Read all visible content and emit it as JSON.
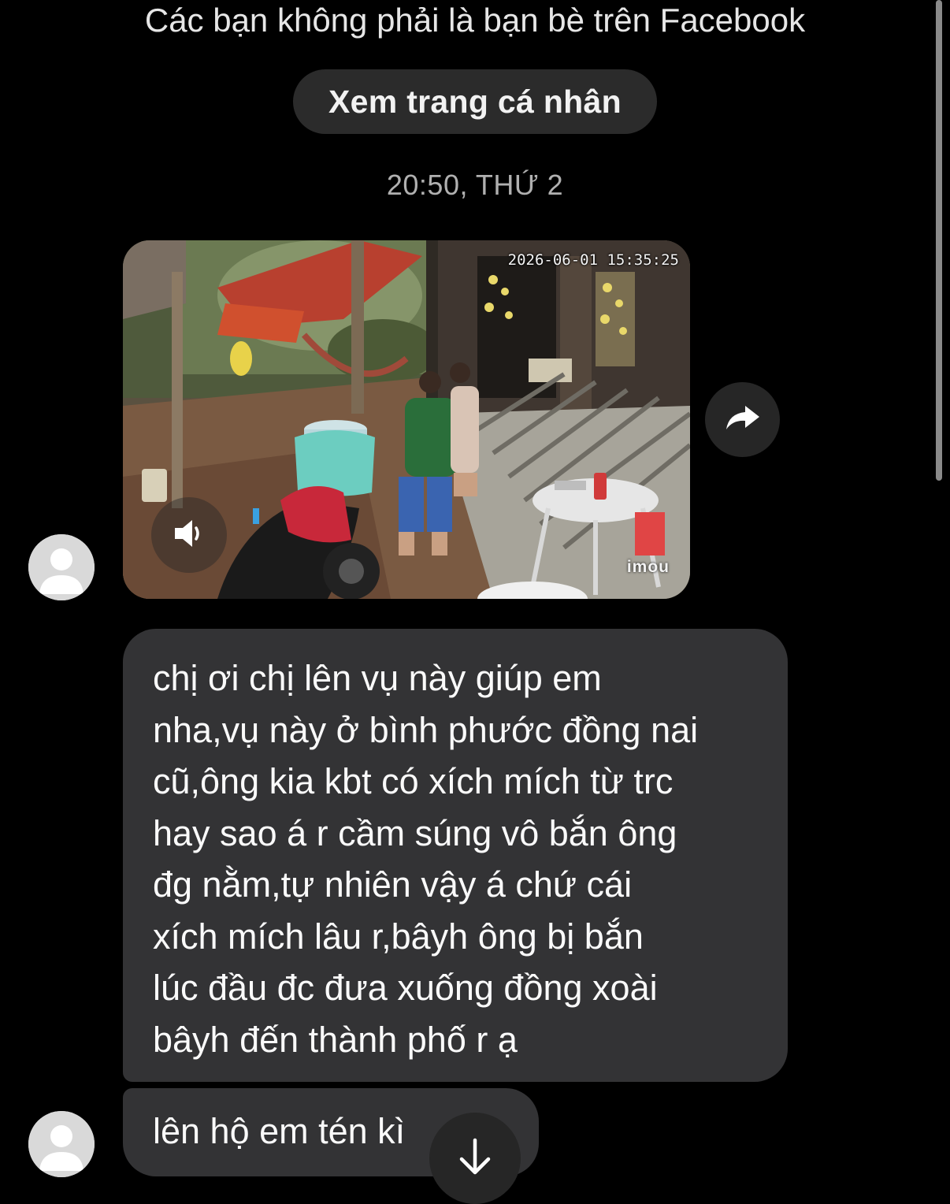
{
  "header": {
    "not_friends_notice": "Các bạn không phải là bạn bè trên Facebook",
    "view_profile_label": "Xem trang cá nhân"
  },
  "conversation": {
    "timestamp": "20:50, THỨ 2"
  },
  "video_message": {
    "camera_timestamp": "2026-06-01 15:35:25",
    "camera_brand": "imou",
    "sound_icon": "speaker-icon",
    "share_icon": "share-arrow-icon"
  },
  "messages": [
    {
      "lines": [
        "chị ơi chị lên vụ này giúp em",
        "nha,vụ này ở bình phước đồng nai",
        "cũ,ông kia kbt có xích mích từ trc",
        "hay sao á r cầm súng vô bắn ông",
        "đg nằm,tự nhiên vậy á chứ cái",
        "xích mích lâu r,bâyh ông bị bắn",
        "lúc đầu đc đưa xuống đồng xoài",
        "bâyh đến thành phố r ạ"
      ]
    },
    {
      "lines": [
        "lên hộ em tén kì"
      ]
    }
  ],
  "controls": {
    "scroll_down_icon": "arrow-down-icon",
    "avatar_icon": "default-avatar-icon"
  },
  "colors": {
    "background": "#000000",
    "bubble": "#333335",
    "pill_button": "#2b2b2b",
    "timestamp_text": "#b0b0b0"
  }
}
